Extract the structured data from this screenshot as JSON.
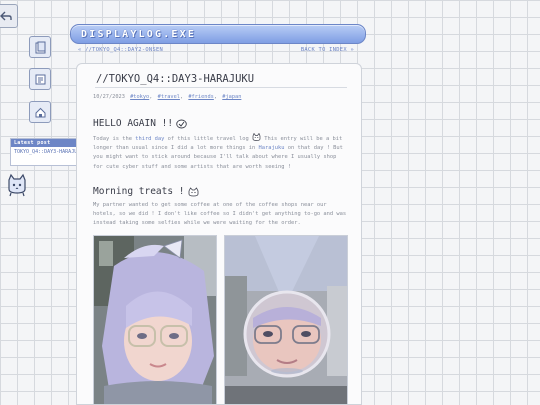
{
  "window": {
    "title": "DISPLAYLOG.EXE"
  },
  "nav": {
    "prev": "« //TOKYO_Q4::DAY2-ONSEN",
    "next": "BACK TO INDEX »"
  },
  "sidebar": {
    "latest_label": "Latest post",
    "latest_link": "TOKYO_Q4::DAY3-HARAJUKU"
  },
  "post": {
    "title": "//TOKYO_Q4::DAY3-HARAJUKU",
    "date": "10/27/2023",
    "tags": [
      "#tokyo",
      "#travel",
      "#friends",
      "#japan"
    ],
    "section1": {
      "heading": "HELLO AGAIN !!",
      "p_a": "Today is the ",
      "p_b": "third day",
      "p_c": " of this little travel log ",
      "p_d": " This entry will be a bit longer than usual since I did a lot more things in ",
      "p_e": "Harajuku",
      "p_f": " on that day ! But you might want to stick around because I'll talk about where I usually shop for cute cyber stuff and some artists that are worth seeing !"
    },
    "section2": {
      "heading": "Morning treats !",
      "text": "My partner wanted to get some coffee at one of the coffee shops near our hotels, so we did ! I don't like coffee so I didn't get anything to-go and was instead taking some selfies while we were waiting for the order."
    }
  },
  "icons": {
    "back": "back-arrow-icon",
    "nav1": "folder-icon",
    "nav2": "notes-icon",
    "nav3": "home-icon",
    "mascot": "cat-mascot-icon"
  },
  "colors": {
    "accent": "#6d86c6",
    "title_bar": "#8fa9e8",
    "text": "#8a8f9a"
  }
}
